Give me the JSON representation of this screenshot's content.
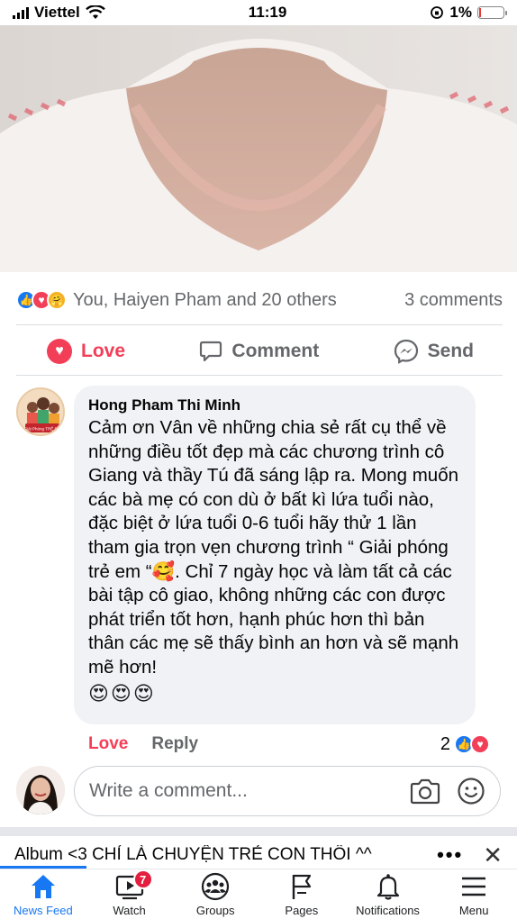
{
  "status_bar": {
    "carrier": "Viettel",
    "time": "11:19",
    "battery": "1%"
  },
  "post": {
    "reactions_text": "You, Haiyen Pham and 20 others",
    "comments_count": "3 comments",
    "actions": {
      "love": "Love",
      "comment": "Comment",
      "send": "Send"
    }
  },
  "comment": {
    "author": "Hong Pham Thi Minh",
    "avatar_text": "Giải Phóng TRẺ EM",
    "text": "Cảm ơn Vân về những chia sẻ rất cụ thể về những điều tốt đẹp mà các chương trình cô Giang và thầy Tú đã sáng lập ra. Mong muốn các bà mẹ có con dù ở bất kì lứa tuổi nào, đặc biệt ở lứa tuổi 0-6 tuổi hãy thử 1 lần tham gia trọn vẹn chương trình “ Giải phóng trẻ em “🥰.  Chỉ 7 ngày học và làm tất cả các bài tập cô giao, không những các con được phát triển tốt hơn, hạnh phúc hơn thì bản thân các mẹ sẽ thấy bình an hơn và sẽ mạnh mẽ hơn!",
    "emoji_line": "😍😍😍",
    "love_label": "Love",
    "reply_label": "Reply",
    "reaction_count": "2"
  },
  "write_comment": {
    "placeholder": "Write a comment..."
  },
  "album_bar": {
    "title": "Album <3 CHỈ LÀ CHUYỆN TRẺ CON THÔI ^^",
    "more": "•••",
    "close": "✕"
  },
  "tabs": [
    {
      "label": "News Feed",
      "icon": "home-icon",
      "active": true
    },
    {
      "label": "Watch",
      "icon": "watch-icon",
      "badge": "7"
    },
    {
      "label": "Groups",
      "icon": "groups-icon"
    },
    {
      "label": "Pages",
      "icon": "flag-icon"
    },
    {
      "label": "Notifications",
      "icon": "bell-icon"
    },
    {
      "label": "Menu",
      "icon": "menu-icon"
    }
  ],
  "colors": {
    "facebook_blue": "#1877f2",
    "love_red": "#f33e58",
    "badge_red": "#e41e3f"
  }
}
